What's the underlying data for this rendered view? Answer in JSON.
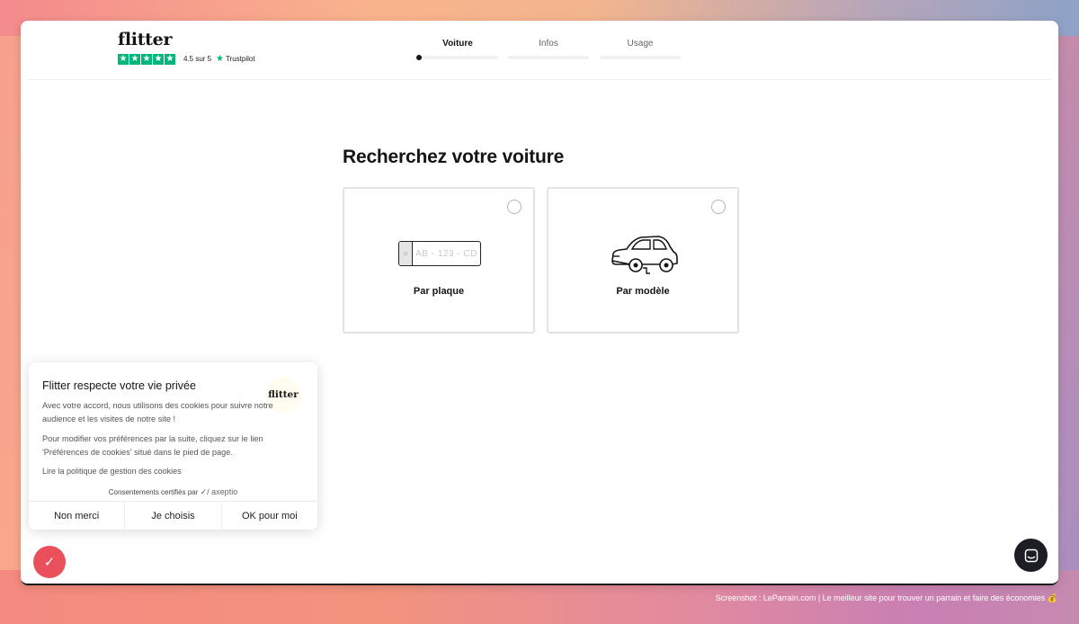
{
  "brand": {
    "logo": "flitter",
    "rating": "4.5 sur 5",
    "trustpilot": "Trustpilot"
  },
  "steps": [
    {
      "label": "Voiture",
      "active": true
    },
    {
      "label": "Infos",
      "active": false
    },
    {
      "label": "Usage",
      "active": false
    }
  ],
  "main": {
    "title": "Recherchez votre voiture",
    "options": [
      {
        "label": "Par plaque",
        "plate_text": "AB - 123 - CD",
        "icon": "license-plate-icon"
      },
      {
        "label": "Par modèle",
        "icon": "car-icon"
      }
    ]
  },
  "cookie": {
    "title": "Flitter respecte votre vie privée",
    "logo": "flitter",
    "paragraph1": "Avec votre accord, nous utilisons des cookies pour suivre notre audience et les visites de notre site !",
    "paragraph2": "Pour modifier vos préférences par la suite, cliquez sur le lien 'Préférences de cookies' situé dans le pied de page.",
    "policy_link": "Lire la politique de gestion des cookies",
    "certified": "Consentements certifiés par",
    "certifier": "axeptio",
    "buttons": {
      "refuse": "Non merci",
      "choose": "Je choisis",
      "accept": "OK pour moi"
    }
  },
  "footer_credit": "Screenshot : LeParrain.com | Le meilleur site pour trouver un parrain et faire des économies 💰",
  "colors": {
    "trustpilot_green": "#00b67a",
    "axeptio_red": "#ea4f5c",
    "chat_dark": "#1c1d25"
  }
}
